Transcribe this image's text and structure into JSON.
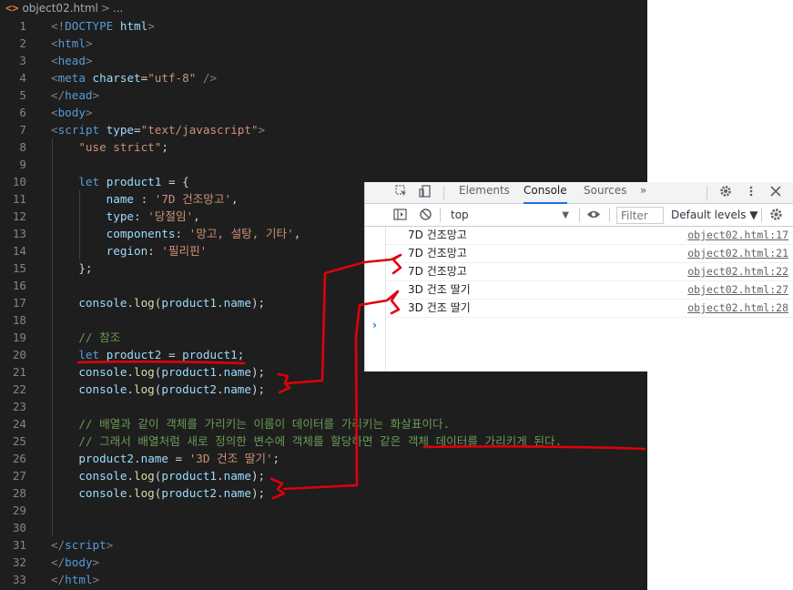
{
  "breadcrumb": {
    "file": "object02.html",
    "chevron": ">",
    "more": "..."
  },
  "editor": {
    "lines": [
      {
        "n": "1",
        "tokens": [
          [
            "p",
            "<!"
          ],
          [
            "t",
            "DOCTYPE"
          ],
          [
            "d",
            " "
          ],
          [
            "a",
            "html"
          ],
          [
            "p",
            ">"
          ]
        ]
      },
      {
        "n": "2",
        "tokens": [
          [
            "p",
            "<"
          ],
          [
            "t",
            "html"
          ],
          [
            "p",
            ">"
          ]
        ]
      },
      {
        "n": "3",
        "tokens": [
          [
            "p",
            "<"
          ],
          [
            "t",
            "head"
          ],
          [
            "p",
            ">"
          ]
        ]
      },
      {
        "n": "4",
        "tokens": [
          [
            "p",
            "<"
          ],
          [
            "t",
            "meta"
          ],
          [
            "d",
            " "
          ],
          [
            "a",
            "charset"
          ],
          [
            "d",
            "="
          ],
          [
            "s",
            "\"utf-8\""
          ],
          [
            "d",
            " "
          ],
          [
            "p",
            "/>"
          ]
        ]
      },
      {
        "n": "5",
        "tokens": [
          [
            "p",
            "</"
          ],
          [
            "t",
            "head"
          ],
          [
            "p",
            ">"
          ]
        ]
      },
      {
        "n": "6",
        "tokens": [
          [
            "p",
            "<"
          ],
          [
            "t",
            "body"
          ],
          [
            "p",
            ">"
          ]
        ]
      },
      {
        "n": "7",
        "tokens": [
          [
            "p",
            "<"
          ],
          [
            "t",
            "script"
          ],
          [
            "d",
            " "
          ],
          [
            "a",
            "type"
          ],
          [
            "d",
            "="
          ],
          [
            "s",
            "\"text/javascript\""
          ],
          [
            "p",
            ">"
          ]
        ]
      },
      {
        "n": "8",
        "tokens": [
          [
            "d",
            "    "
          ],
          [
            "s",
            "\"use strict\""
          ],
          [
            "d",
            ";"
          ]
        ]
      },
      {
        "n": "9",
        "tokens": []
      },
      {
        "n": "10",
        "tokens": [
          [
            "d",
            "    "
          ],
          [
            "k",
            "let"
          ],
          [
            "d",
            " "
          ],
          [
            "v",
            "product1"
          ],
          [
            "d",
            " = {"
          ]
        ]
      },
      {
        "n": "11",
        "tokens": [
          [
            "d",
            "        "
          ],
          [
            "v",
            "name"
          ],
          [
            "d",
            " : "
          ],
          [
            "s",
            "'7D 건조망고'"
          ],
          [
            "d",
            ","
          ]
        ]
      },
      {
        "n": "12",
        "tokens": [
          [
            "d",
            "        "
          ],
          [
            "v",
            "type"
          ],
          [
            "d",
            ": "
          ],
          [
            "s",
            "'당절임'"
          ],
          [
            "d",
            ","
          ]
        ]
      },
      {
        "n": "13",
        "tokens": [
          [
            "d",
            "        "
          ],
          [
            "v",
            "components"
          ],
          [
            "d",
            ": "
          ],
          [
            "s",
            "'망고, 설탕, 기타'"
          ],
          [
            "d",
            ","
          ]
        ]
      },
      {
        "n": "14",
        "tokens": [
          [
            "d",
            "        "
          ],
          [
            "v",
            "region"
          ],
          [
            "d",
            ": "
          ],
          [
            "s",
            "'필리핀'"
          ]
        ]
      },
      {
        "n": "15",
        "tokens": [
          [
            "d",
            "    };"
          ]
        ]
      },
      {
        "n": "16",
        "tokens": []
      },
      {
        "n": "17",
        "tokens": [
          [
            "d",
            "    "
          ],
          [
            "v",
            "console"
          ],
          [
            "d",
            "."
          ],
          [
            "f",
            "log"
          ],
          [
            "d",
            "("
          ],
          [
            "v",
            "product1"
          ],
          [
            "d",
            "."
          ],
          [
            "v",
            "name"
          ],
          [
            "d",
            ");"
          ]
        ]
      },
      {
        "n": "18",
        "tokens": []
      },
      {
        "n": "19",
        "tokens": [
          [
            "d",
            "    "
          ],
          [
            "c",
            "// 참조"
          ]
        ]
      },
      {
        "n": "20",
        "tokens": [
          [
            "d",
            "    "
          ],
          [
            "k",
            "let"
          ],
          [
            "d",
            " "
          ],
          [
            "v",
            "product2"
          ],
          [
            "d",
            " = "
          ],
          [
            "v",
            "product1"
          ],
          [
            "d",
            ";"
          ]
        ]
      },
      {
        "n": "21",
        "tokens": [
          [
            "d",
            "    "
          ],
          [
            "v",
            "console"
          ],
          [
            "d",
            "."
          ],
          [
            "f",
            "log"
          ],
          [
            "d",
            "("
          ],
          [
            "v",
            "product1"
          ],
          [
            "d",
            "."
          ],
          [
            "v",
            "name"
          ],
          [
            "d",
            ");"
          ]
        ]
      },
      {
        "n": "22",
        "tokens": [
          [
            "d",
            "    "
          ],
          [
            "v",
            "console"
          ],
          [
            "d",
            "."
          ],
          [
            "f",
            "log"
          ],
          [
            "d",
            "("
          ],
          [
            "v",
            "product2"
          ],
          [
            "d",
            "."
          ],
          [
            "v",
            "name"
          ],
          [
            "d",
            ");"
          ]
        ]
      },
      {
        "n": "23",
        "tokens": []
      },
      {
        "n": "24",
        "tokens": [
          [
            "d",
            "    "
          ],
          [
            "c",
            "// 배열과 같이 객체를 가리키는 이름이 데이터를 가리키는 화살표이다."
          ]
        ]
      },
      {
        "n": "25",
        "tokens": [
          [
            "d",
            "    "
          ],
          [
            "c",
            "// 그래서 배열처럼 새로 정의한 변수에 객체를 할당하면 같은 객체 데이터를 가리키게 된다."
          ]
        ]
      },
      {
        "n": "26",
        "tokens": [
          [
            "d",
            "    "
          ],
          [
            "v",
            "product2"
          ],
          [
            "d",
            "."
          ],
          [
            "v",
            "name"
          ],
          [
            "d",
            " = "
          ],
          [
            "s",
            "'3D 건조 딸기'"
          ],
          [
            "d",
            ";"
          ]
        ]
      },
      {
        "n": "27",
        "tokens": [
          [
            "d",
            "    "
          ],
          [
            "v",
            "console"
          ],
          [
            "d",
            "."
          ],
          [
            "f",
            "log"
          ],
          [
            "d",
            "("
          ],
          [
            "v",
            "product1"
          ],
          [
            "d",
            "."
          ],
          [
            "v",
            "name"
          ],
          [
            "d",
            ");"
          ]
        ]
      },
      {
        "n": "28",
        "tokens": [
          [
            "d",
            "    "
          ],
          [
            "v",
            "console"
          ],
          [
            "d",
            "."
          ],
          [
            "f",
            "log"
          ],
          [
            "d",
            "("
          ],
          [
            "v",
            "product2"
          ],
          [
            "d",
            "."
          ],
          [
            "v",
            "name"
          ],
          [
            "d",
            ");"
          ]
        ]
      },
      {
        "n": "29",
        "tokens": []
      },
      {
        "n": "30",
        "tokens": []
      },
      {
        "n": "31",
        "tokens": [
          [
            "p",
            "</"
          ],
          [
            "t",
            "script"
          ],
          [
            "p",
            ">"
          ]
        ]
      },
      {
        "n": "32",
        "tokens": [
          [
            "p",
            "</"
          ],
          [
            "t",
            "body"
          ],
          [
            "p",
            ">"
          ]
        ]
      },
      {
        "n": "33",
        "tokens": [
          [
            "p",
            "</"
          ],
          [
            "t",
            "html"
          ],
          [
            "p",
            ">"
          ]
        ]
      }
    ]
  },
  "devtools": {
    "tabs": [
      "Elements",
      "Console",
      "Sources"
    ],
    "active_tab": "Console",
    "more_tabs": "»",
    "context": "top",
    "filter_placeholder": "Filter",
    "levels": "Default levels ▼",
    "messages": [
      {
        "text": "7D 건조망고",
        "source": "object02.html:17"
      },
      {
        "text": "7D 건조망고",
        "source": "object02.html:21"
      },
      {
        "text": "7D 건조망고",
        "source": "object02.html:22"
      },
      {
        "text": "3D 건조 딸기",
        "source": "object02.html:27"
      },
      {
        "text": "3D 건조 딸기",
        "source": "object02.html:28"
      }
    ],
    "prompt": "›"
  },
  "colors": {
    "annotation": "#e0000b",
    "tab_accent": "#1a73e8"
  },
  "icons": [
    "inspect-icon",
    "device-icon",
    "settings-icon",
    "more-icon",
    "close-icon",
    "sidebar-icon",
    "clear-icon",
    "eye-icon",
    "gear-icon"
  ]
}
